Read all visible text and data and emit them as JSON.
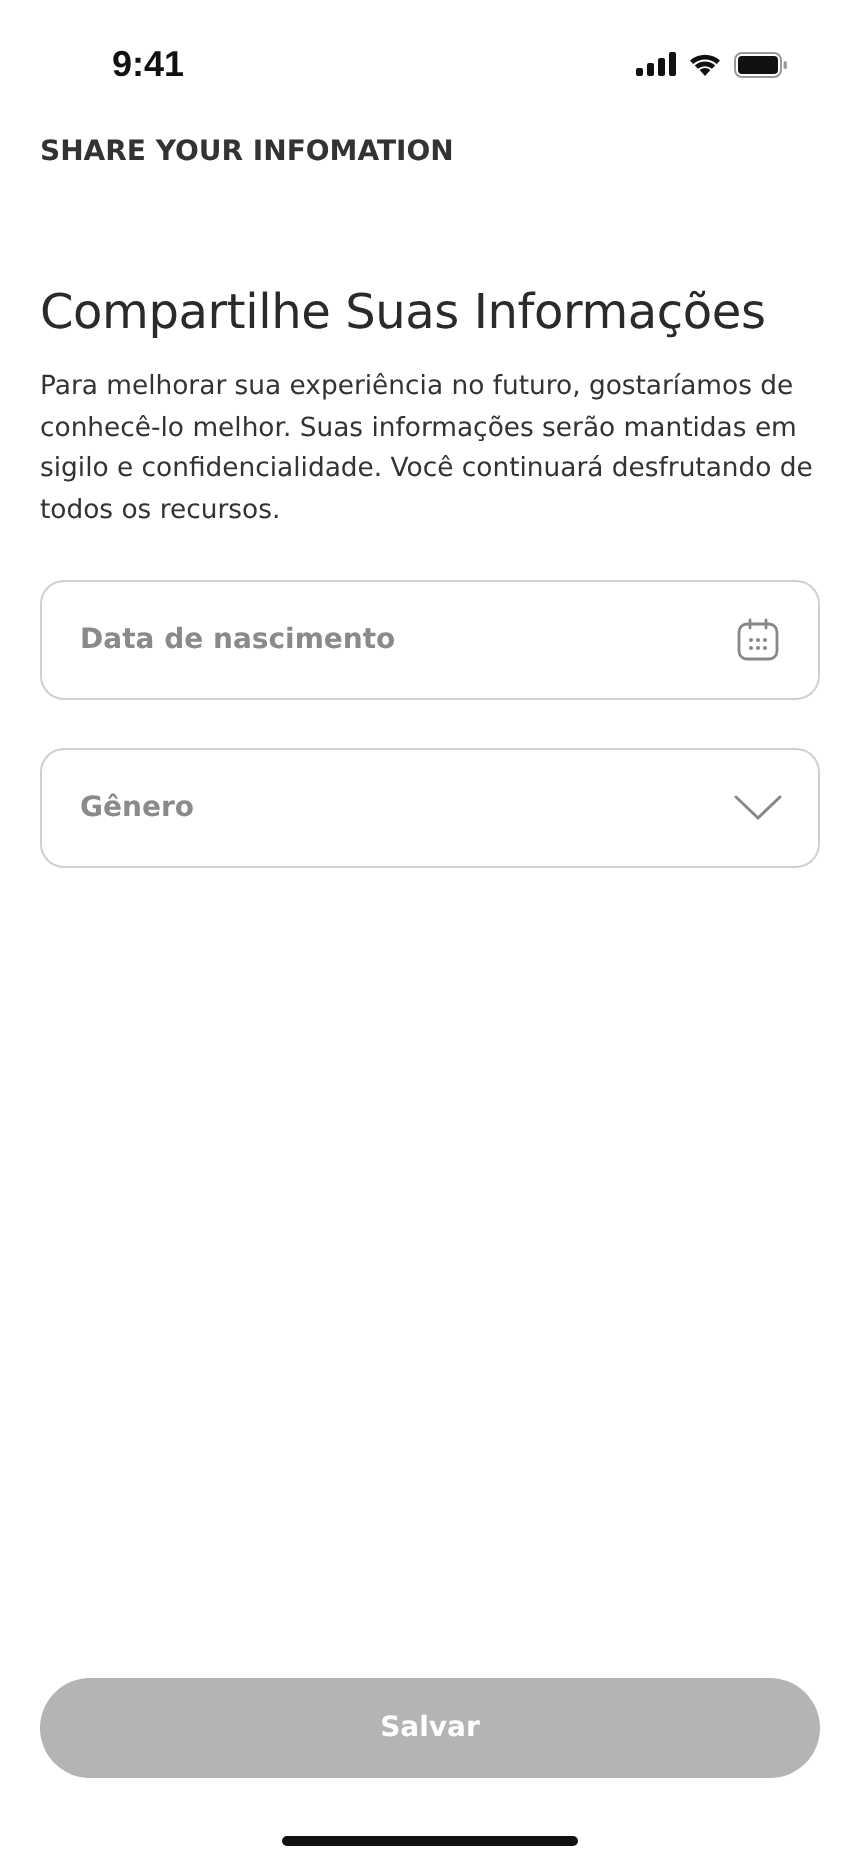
{
  "status_bar": {
    "time": "9:41"
  },
  "header": {
    "title": "SHARE YOUR INFOMATION"
  },
  "heading": "Compartilhe Suas Informações",
  "description": "Para melhorar sua experiência no futuro, gostaríamos de conhecê-lo melhor. Suas informações serão mantidas em sigilo e confidencialidade. Você continuará desfrutando de todos os recursos.",
  "fields": [
    {
      "kind": "date",
      "placeholder": "Data de nascimento"
    },
    {
      "kind": "select",
      "placeholder": "Gênero"
    }
  ],
  "save_button": {
    "label": "Salvar",
    "disabled": true
  }
}
